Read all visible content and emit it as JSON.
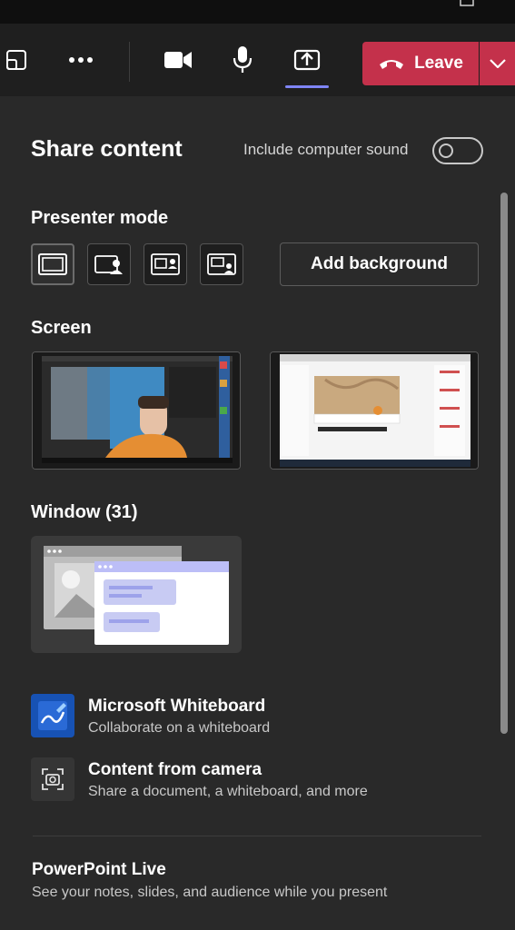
{
  "toolbar": {
    "leave_label": "Leave",
    "icons": [
      "popout-icon",
      "more-icon",
      "camera-icon",
      "microphone-icon",
      "share-icon",
      "phone-hangup-icon",
      "chevron-down-icon"
    ]
  },
  "panel": {
    "title": "Share content",
    "include_sound_label": "Include computer sound",
    "include_sound_on": false
  },
  "presenter": {
    "section_label": "Presenter mode",
    "add_background_label": "Add background",
    "modes": [
      "content-only",
      "standout",
      "side-by-side",
      "reporter"
    ]
  },
  "screen": {
    "section_label": "Screen"
  },
  "window": {
    "section_label": "Window (31)"
  },
  "apps": [
    {
      "title": "Microsoft Whiteboard",
      "subtitle": "Collaborate on a whiteboard"
    },
    {
      "title": "Content from camera",
      "subtitle": "Share a document, a whiteboard, and more"
    }
  ],
  "powerpoint": {
    "title": "PowerPoint Live",
    "subtitle": "See your notes, slides, and audience while you present"
  },
  "colors": {
    "leave": "#c4314b",
    "accent": "#7f85f5",
    "panel_bg": "#292929"
  }
}
